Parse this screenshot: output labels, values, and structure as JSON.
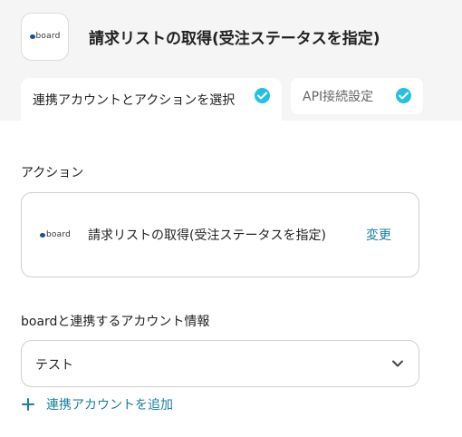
{
  "header": {
    "app_logo_text": "board",
    "title": "請求リストの取得(受注ステータスを指定)"
  },
  "tabs": [
    {
      "label": "連携アカウントとアクションを選択",
      "completed": true
    },
    {
      "label": "API接続設定",
      "completed": true
    }
  ],
  "action_section": {
    "heading": "アクション",
    "logo_text": "board",
    "action_name": "請求リストの取得(受注ステータスを指定)",
    "change_label": "変更"
  },
  "account_section": {
    "heading": "boardと連携するアカウント情報",
    "selected_account": "テスト",
    "add_account_label": "連携アカウントを追加"
  },
  "colors": {
    "accent": "#1a7e9e",
    "check": "#22c1e3",
    "background_top": "#f5f5f5"
  }
}
